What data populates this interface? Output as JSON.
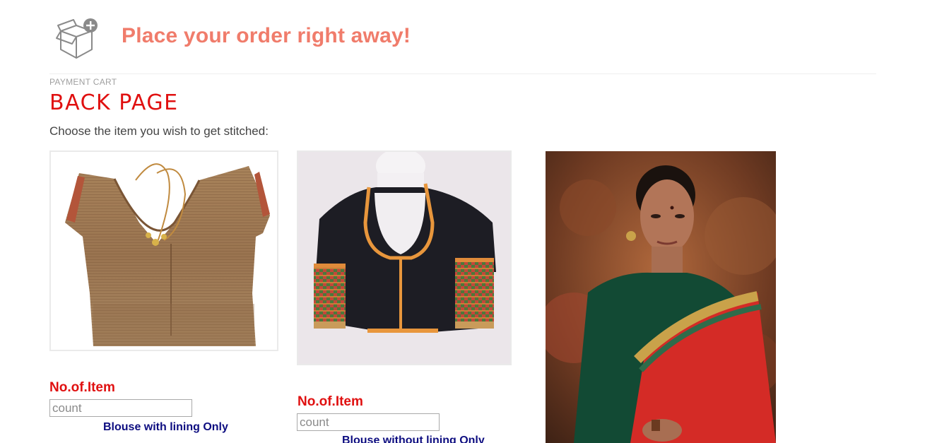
{
  "header": {
    "icon": "box-plus-icon",
    "title": "Place your order right away!"
  },
  "breadcrumb": "PAYMENT CART",
  "page_title": "BACK PAGE",
  "instruction": "Choose the item you wish to get stitched:",
  "items": [
    {
      "image": "golden-tissue-blouse-image",
      "qty_label": "No.of.Item",
      "qty_placeholder": "count",
      "caption": "Blouse with lining Only"
    },
    {
      "image": "black-checked-sleeve-blouse-image",
      "qty_label": "No.of.Item",
      "qty_placeholder": "count",
      "caption": "Blouse without lining Only"
    },
    {
      "image": "woman-red-saree-green-blouse-image"
    }
  ],
  "colors": {
    "header_title": "#f07c6b",
    "page_title": "#e01010",
    "qty_label": "#e01010",
    "caption": "#0d0d80"
  }
}
